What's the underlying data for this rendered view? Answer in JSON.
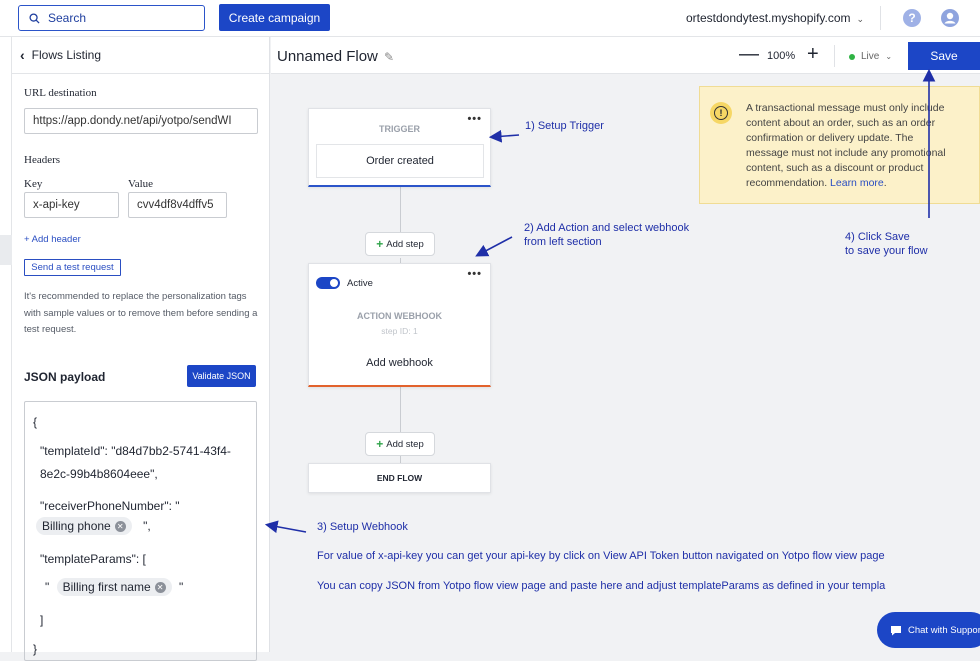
{
  "topbar": {
    "search_label": "Search",
    "create_label": "Create campaign",
    "store_name": "ortestdondytest.myshopify.com",
    "help_glyph": "?"
  },
  "sidebar": {
    "back_label": "Flows Listing",
    "url_label": "URL destination",
    "url_value": "https://app.dondy.net/api/yotpo/sendWI",
    "headers_label": "Headers",
    "key_label": "Key",
    "value_label": "Value",
    "key_value": "x-api-key",
    "value_value": "cvv4df8v4dffv5",
    "add_header_label": "+ Add header",
    "test_button_label": "Send a test request",
    "note": "It's recommended to replace the personalization tags with sample values or to remove them before sending a test request.",
    "json_title": "JSON payload",
    "validate_label": "Validate JSON",
    "json_lines": {
      "open": "{",
      "template_id_1": "\"templateId\": \"d84d7bb2-5741-43f4-",
      "template_id_2": "8e2c-99b4b8604eee\",",
      "receiver": "\"receiverPhoneNumber\": \"",
      "chip_phone": "Billing phone",
      "after_phone": "\",",
      "params": "\"templateParams\": [",
      "quote_open": "\"",
      "chip_first_name": "Billing first name",
      "quote_close": "\"",
      "bracket_close": "]",
      "brace_close": "}"
    }
  },
  "flowbar": {
    "title": "Unnamed Flow",
    "zoom_minus": "—",
    "zoom": "100%",
    "zoom_plus": "+",
    "live_label": "Live",
    "save_label": "Save"
  },
  "nodes": {
    "dots": "•••",
    "trigger_header": "TRIGGER",
    "trigger_event": "Order created",
    "add_step": "Add step",
    "active_label": "Active",
    "action_header": "ACTION WEBHOOK",
    "step_id": "step ID: 1",
    "action_body": "Add webhook",
    "end_label": "END FLOW"
  },
  "annotations": {
    "step1": "1) Setup Trigger",
    "step2_line1": "2) Add Action and select webhook",
    "step2_line2": "from left section",
    "step3": "3) Setup Webhook",
    "step4_line1": "4) Click Save",
    "step4_line2": "to save your flow",
    "note_api_key": "For value of x-api-key you can get your api-key by click on View API Token button navigated on Yotpo flow view page",
    "note_json": "You can copy JSON from Yotpo flow view page and paste here and adjust templateParams as defined in your templa"
  },
  "warning": {
    "text": "A transactional message must only include content about an order, such as an order confirmation or delivery update. The message must not include any promotional content, such as a discount or product recommendation.",
    "link": "Learn more",
    "end": "."
  },
  "chat": {
    "label": "Chat with Support"
  },
  "colors": {
    "primary": "#1c46c6",
    "annotation": "#1f2fa8",
    "warning_bg": "#fcf1c9",
    "trigger_line": "#2b54c9",
    "action_line": "#e2622c"
  }
}
